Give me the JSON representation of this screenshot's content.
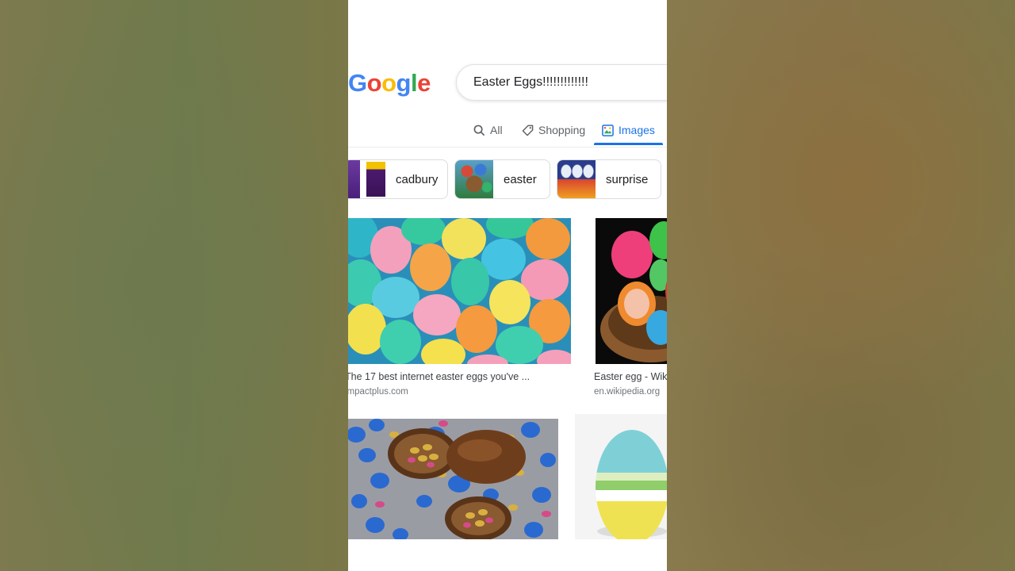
{
  "logo": {
    "letters": [
      {
        "ch": "G",
        "color": "#4285F4"
      },
      {
        "ch": "o",
        "color": "#EA4335"
      },
      {
        "ch": "o",
        "color": "#FBBC05"
      },
      {
        "ch": "g",
        "color": "#4285F4"
      },
      {
        "ch": "l",
        "color": "#34A853"
      },
      {
        "ch": "e",
        "color": "#EA4335"
      }
    ]
  },
  "search": {
    "query": "Easter Eggs!!!!!!!!!!!!!"
  },
  "tabs": [
    {
      "label": "All",
      "icon": "search-icon"
    },
    {
      "label": "Shopping",
      "icon": "tag-icon"
    },
    {
      "label": "Images",
      "icon": "image-icon",
      "active": true
    }
  ],
  "chips": [
    {
      "label": "cadbury"
    },
    {
      "label": "easter"
    },
    {
      "label": "surprise"
    }
  ],
  "results": [
    {
      "title": "The 17 best internet easter eggs you've ...",
      "source": "impactplus.com"
    },
    {
      "title": "Easter egg - Wikipedia",
      "source": "en.wikipedia.org"
    }
  ],
  "colors": {
    "accent": "#1a73e8",
    "text": "#202124",
    "muted": "#70757a"
  }
}
